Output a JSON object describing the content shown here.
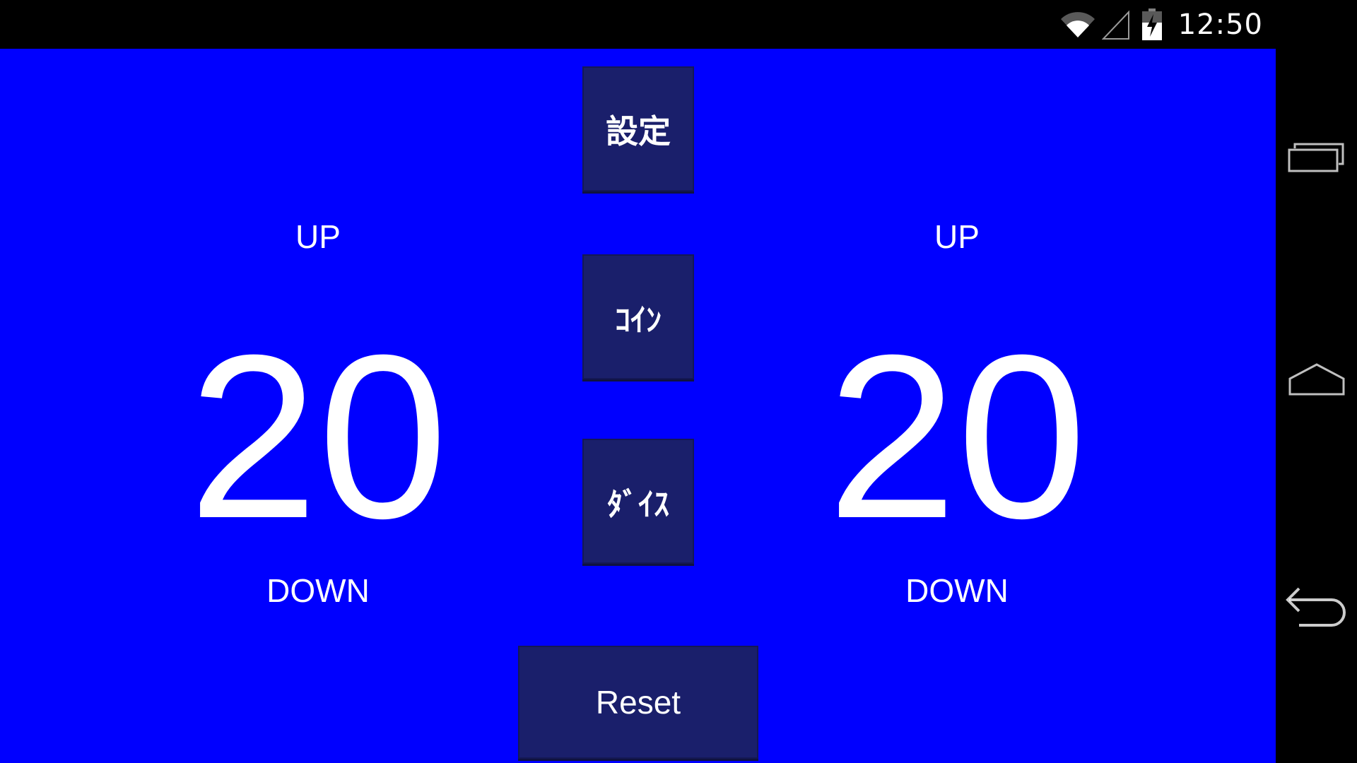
{
  "status_bar": {
    "time": "12:50",
    "icons": [
      "wifi-icon",
      "signal-icon",
      "battery-icon"
    ]
  },
  "colors": {
    "app_background": "#0000ff",
    "button_background": "#1a1f6b",
    "text": "#ffffff",
    "system_bars": "#000000"
  },
  "left_counter": {
    "up_label": "UP",
    "value": "20",
    "down_label": "DOWN"
  },
  "right_counter": {
    "up_label": "UP",
    "value": "20",
    "down_label": "DOWN"
  },
  "buttons": {
    "settings": "設定",
    "coin": "ｺｲﾝ",
    "dice": "ﾀﾞｲｽ",
    "reset": "Reset"
  },
  "nav_bar": {
    "icons": [
      "recents-icon",
      "home-icon",
      "back-icon"
    ]
  }
}
